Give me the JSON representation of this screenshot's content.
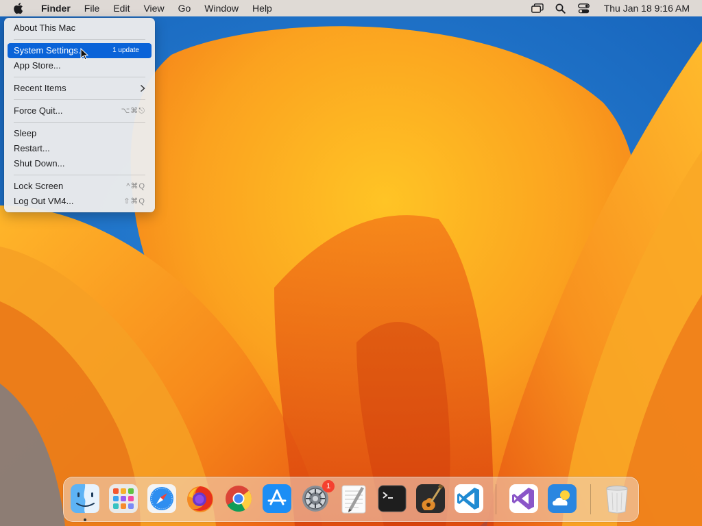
{
  "menubar": {
    "apple_icon": "apple-logo-icon",
    "app_name": "Finder",
    "menus": [
      "File",
      "Edit",
      "View",
      "Go",
      "Window",
      "Help"
    ],
    "status_icons": [
      "screen-mirroring-icon",
      "search-icon",
      "control-center-icon"
    ],
    "clock": "Thu Jan 18  9:16 AM"
  },
  "apple_menu": {
    "about": "About This Mac",
    "system_settings": "System Settings...",
    "system_settings_badge": "1 update",
    "app_store": "App Store...",
    "recent_items": "Recent Items",
    "force_quit": "Force Quit...",
    "force_quit_shortcut": "⌥⌘⎋",
    "sleep": "Sleep",
    "restart": "Restart...",
    "shut_down": "Shut Down...",
    "lock_screen": "Lock Screen",
    "lock_screen_shortcut": "^⌘Q",
    "log_out": "Log Out VM4...",
    "log_out_shortcut": "⇧⌘Q"
  },
  "dock": {
    "items": [
      "finder-icon",
      "launchpad-icon",
      "safari-icon",
      "firefox-icon",
      "chrome-icon",
      "app-store-icon",
      "system-settings-icon",
      "textedit-icon",
      "terminal-icon",
      "garageband-icon",
      "vscode-icon",
      "visual-studio-icon",
      "weather-icon",
      "trash-icon"
    ],
    "system_settings_badge": "1"
  },
  "colors": {
    "highlight": "#0a63d8",
    "badge_red": "#f5402f",
    "wallpaper_orange": "#f7941d",
    "wallpaper_blue": "#1c73c9"
  }
}
